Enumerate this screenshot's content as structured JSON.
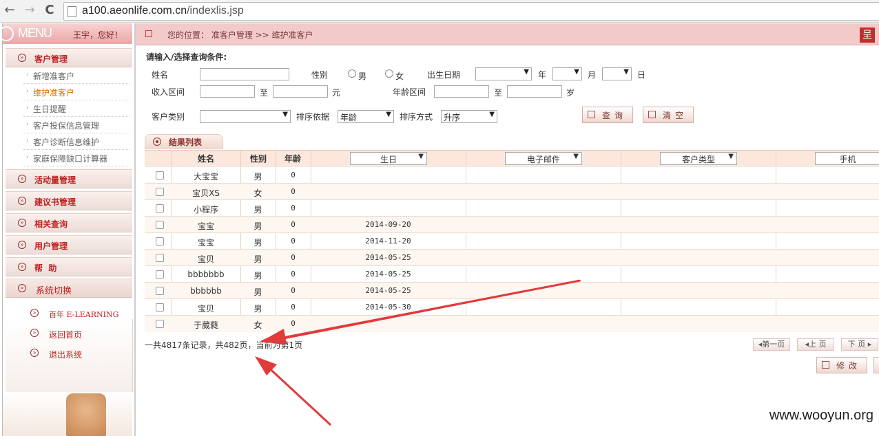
{
  "browser": {
    "url_host": "a100.aeonlife.com.cn",
    "url_path": "/indexlis.jsp",
    "back_label": "←",
    "forward_label": "→",
    "reload_label": "C"
  },
  "sidebar": {
    "menu_title": "MENU",
    "greeting": "王宇，您好！",
    "groups": [
      {
        "label": "客户管理"
      },
      {
        "label": "活动量管理"
      },
      {
        "label": "建议书管理"
      },
      {
        "label": "相关查询"
      },
      {
        "label": "用户管理"
      },
      {
        "label": "帮  助"
      },
      {
        "label": "系统切换"
      }
    ],
    "sub_items": [
      {
        "label": "新增准客户"
      },
      {
        "label": "维护准客户"
      },
      {
        "label": "生日提醒"
      },
      {
        "label": "客户投保信息管理"
      },
      {
        "label": "客户诊断信息维护"
      },
      {
        "label": "家庭保障缺口计算器"
      }
    ],
    "links": [
      {
        "label": "百年 E-LEARNING"
      },
      {
        "label": "返回首页"
      },
      {
        "label": "退出系统"
      }
    ]
  },
  "breadcrumb": {
    "text": "您的位置： 准客户管理 >> 维护准客户",
    "logo": "呈"
  },
  "form": {
    "title": "请输入/选择查询条件:",
    "name_label": "姓名",
    "gender_label": "性别",
    "male": "男",
    "female": "女",
    "birth_label": "出生日期",
    "year": "年",
    "month": "月",
    "day": "日",
    "income_label": "收入区间",
    "to": "至",
    "yuan": "元",
    "age_label": "年龄区间",
    "sui": "岁",
    "type_label": "客户类别",
    "sort_by_label": "排序依据",
    "sort_by_value": "年龄",
    "sort_order_label": "排序方式",
    "sort_order_value": "升序",
    "query_button": "查询",
    "clear_button": "清空"
  },
  "results": {
    "tab_label": "结果列表",
    "headers": {
      "name": "姓名",
      "gender": "性别",
      "age": "年龄",
      "birthday": "生日",
      "email": "电子邮件",
      "type": "客户类型",
      "mobile": "手机"
    },
    "rows": [
      {
        "name": "大宝宝",
        "gender": "男",
        "age": "0",
        "birthday": ""
      },
      {
        "name": "宝贝XS",
        "gender": "女",
        "age": "0",
        "birthday": ""
      },
      {
        "name": "小程序",
        "gender": "男",
        "age": "0",
        "birthday": ""
      },
      {
        "name": "宝宝",
        "gender": "男",
        "age": "0",
        "birthday": "2014-09-20"
      },
      {
        "name": "宝宝",
        "gender": "男",
        "age": "0",
        "birthday": "2014-11-20"
      },
      {
        "name": "宝贝",
        "gender": "男",
        "age": "0",
        "birthday": "2014-05-25"
      },
      {
        "name": "bbbbbbb",
        "gender": "男",
        "age": "0",
        "birthday": "2014-05-25"
      },
      {
        "name": "bbbbbb",
        "gender": "男",
        "age": "0",
        "birthday": "2014-05-25"
      },
      {
        "name": "宝贝",
        "gender": "男",
        "age": "0",
        "birthday": "2014-05-30"
      },
      {
        "name": "于葳蕤",
        "gender": "女",
        "age": "0",
        "birthday": ""
      }
    ],
    "summary": "一共4817条记录，共482页，当前为第1页",
    "first_page": "◂第一页",
    "prev_page": "◂上 页",
    "next_page": "下 页 ▸",
    "edit_button": "修改"
  },
  "watermark": "www.wooyun.org",
  "colors": {
    "accent": "#c02020",
    "header_bar": "#f3caca",
    "arrow": "#e23a3a"
  }
}
